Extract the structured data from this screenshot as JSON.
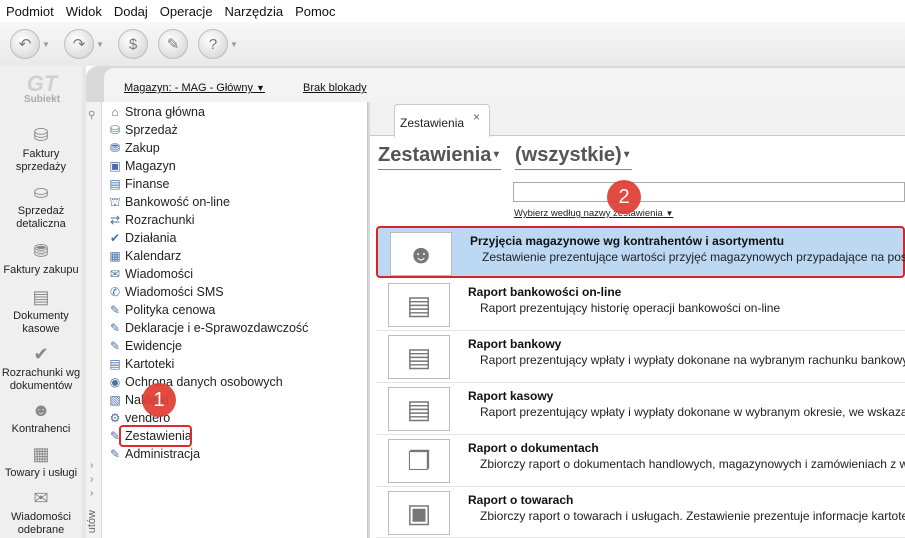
{
  "menu": [
    "Podmiot",
    "Widok",
    "Dodaj",
    "Operacje",
    "Narzędzia",
    "Pomoc"
  ],
  "app": {
    "logo_big": "GT",
    "logo_small": "Subiekt"
  },
  "leftnav": [
    {
      "label": "Faktury sprzedaży",
      "icon": "coins-icon"
    },
    {
      "label": "Sprzedaż detaliczna",
      "icon": "cash-register-icon"
    },
    {
      "label": "Faktury zakupu",
      "icon": "coins-stack-icon"
    },
    {
      "label": "Dokumenty kasowe",
      "icon": "cash-documents-icon"
    },
    {
      "label": "Rozrachunki wg dokumentów",
      "icon": "settlements-icon"
    },
    {
      "label": "Kontrahenci",
      "icon": "person-icon"
    },
    {
      "label": "Towary i usługi",
      "icon": "goods-icon"
    },
    {
      "label": "Wiadomości odebrane",
      "icon": "messages-icon"
    }
  ],
  "header": {
    "magazyn": "Magazyn: - MAG - Główny",
    "blokada": "Brak blokady"
  },
  "modules": [
    "Strona główna",
    "Sprzedaż",
    "Zakup",
    "Magazyn",
    "Finanse",
    "Bankowość on-line",
    "Rozrachunki",
    "Działania",
    "Kalendarz",
    "Wiadomości",
    "Wiadomości SMS",
    "Polityka cenowa",
    "Deklaracje i e-Sprawozdawczość",
    "Ewidencje",
    "Kartoteki",
    "Ochrona danych osobowych",
    "Naklejki",
    "vendero",
    "Zestawienia",
    "Administracja"
  ],
  "modules_vertical_label": "utów",
  "badges": {
    "one": "1",
    "two": "2"
  },
  "tab": {
    "label": "Zestawienia",
    "close": "×"
  },
  "filters": {
    "category": "Zestawienia",
    "scope": "(wszystkie)",
    "sort": "Wybierz według nazwy zestawienia"
  },
  "reports": [
    {
      "title": "Przyjęcia magazynowe wg kontrahentów i asortymentu",
      "desc": "Zestawienie prezentujące wartości przyjęć magazynowych przypadające na poszcze",
      "icon": "person-icon",
      "selected": true
    },
    {
      "title": "Raport bankowości on-line",
      "desc": "Raport prezentujący historię operacji bankowości on-line",
      "icon": "money-stack-icon",
      "selected": false
    },
    {
      "title": "Raport bankowy",
      "desc": "Raport prezentujący wpłaty i wypłaty dokonane na wybranym rachunku bankowym",
      "icon": "money-stack-icon",
      "selected": false
    },
    {
      "title": "Raport kasowy",
      "desc": "Raport prezentujący wpłaty i wypłaty dokonane w wybranym okresie, we wskazanej",
      "icon": "money-stack-icon",
      "selected": false
    },
    {
      "title": "Raport o dokumentach",
      "desc": "Zbiorczy raport o dokumentach handlowych, magazynowych i zamówieniach z wyb",
      "icon": "documents-icon",
      "selected": false
    },
    {
      "title": "Raport o towarach",
      "desc": "Zbiorczy raport o towarach i usługach. Zestawienie prezentuje informacje kartoteko",
      "icon": "boxes-icon",
      "selected": false
    }
  ]
}
